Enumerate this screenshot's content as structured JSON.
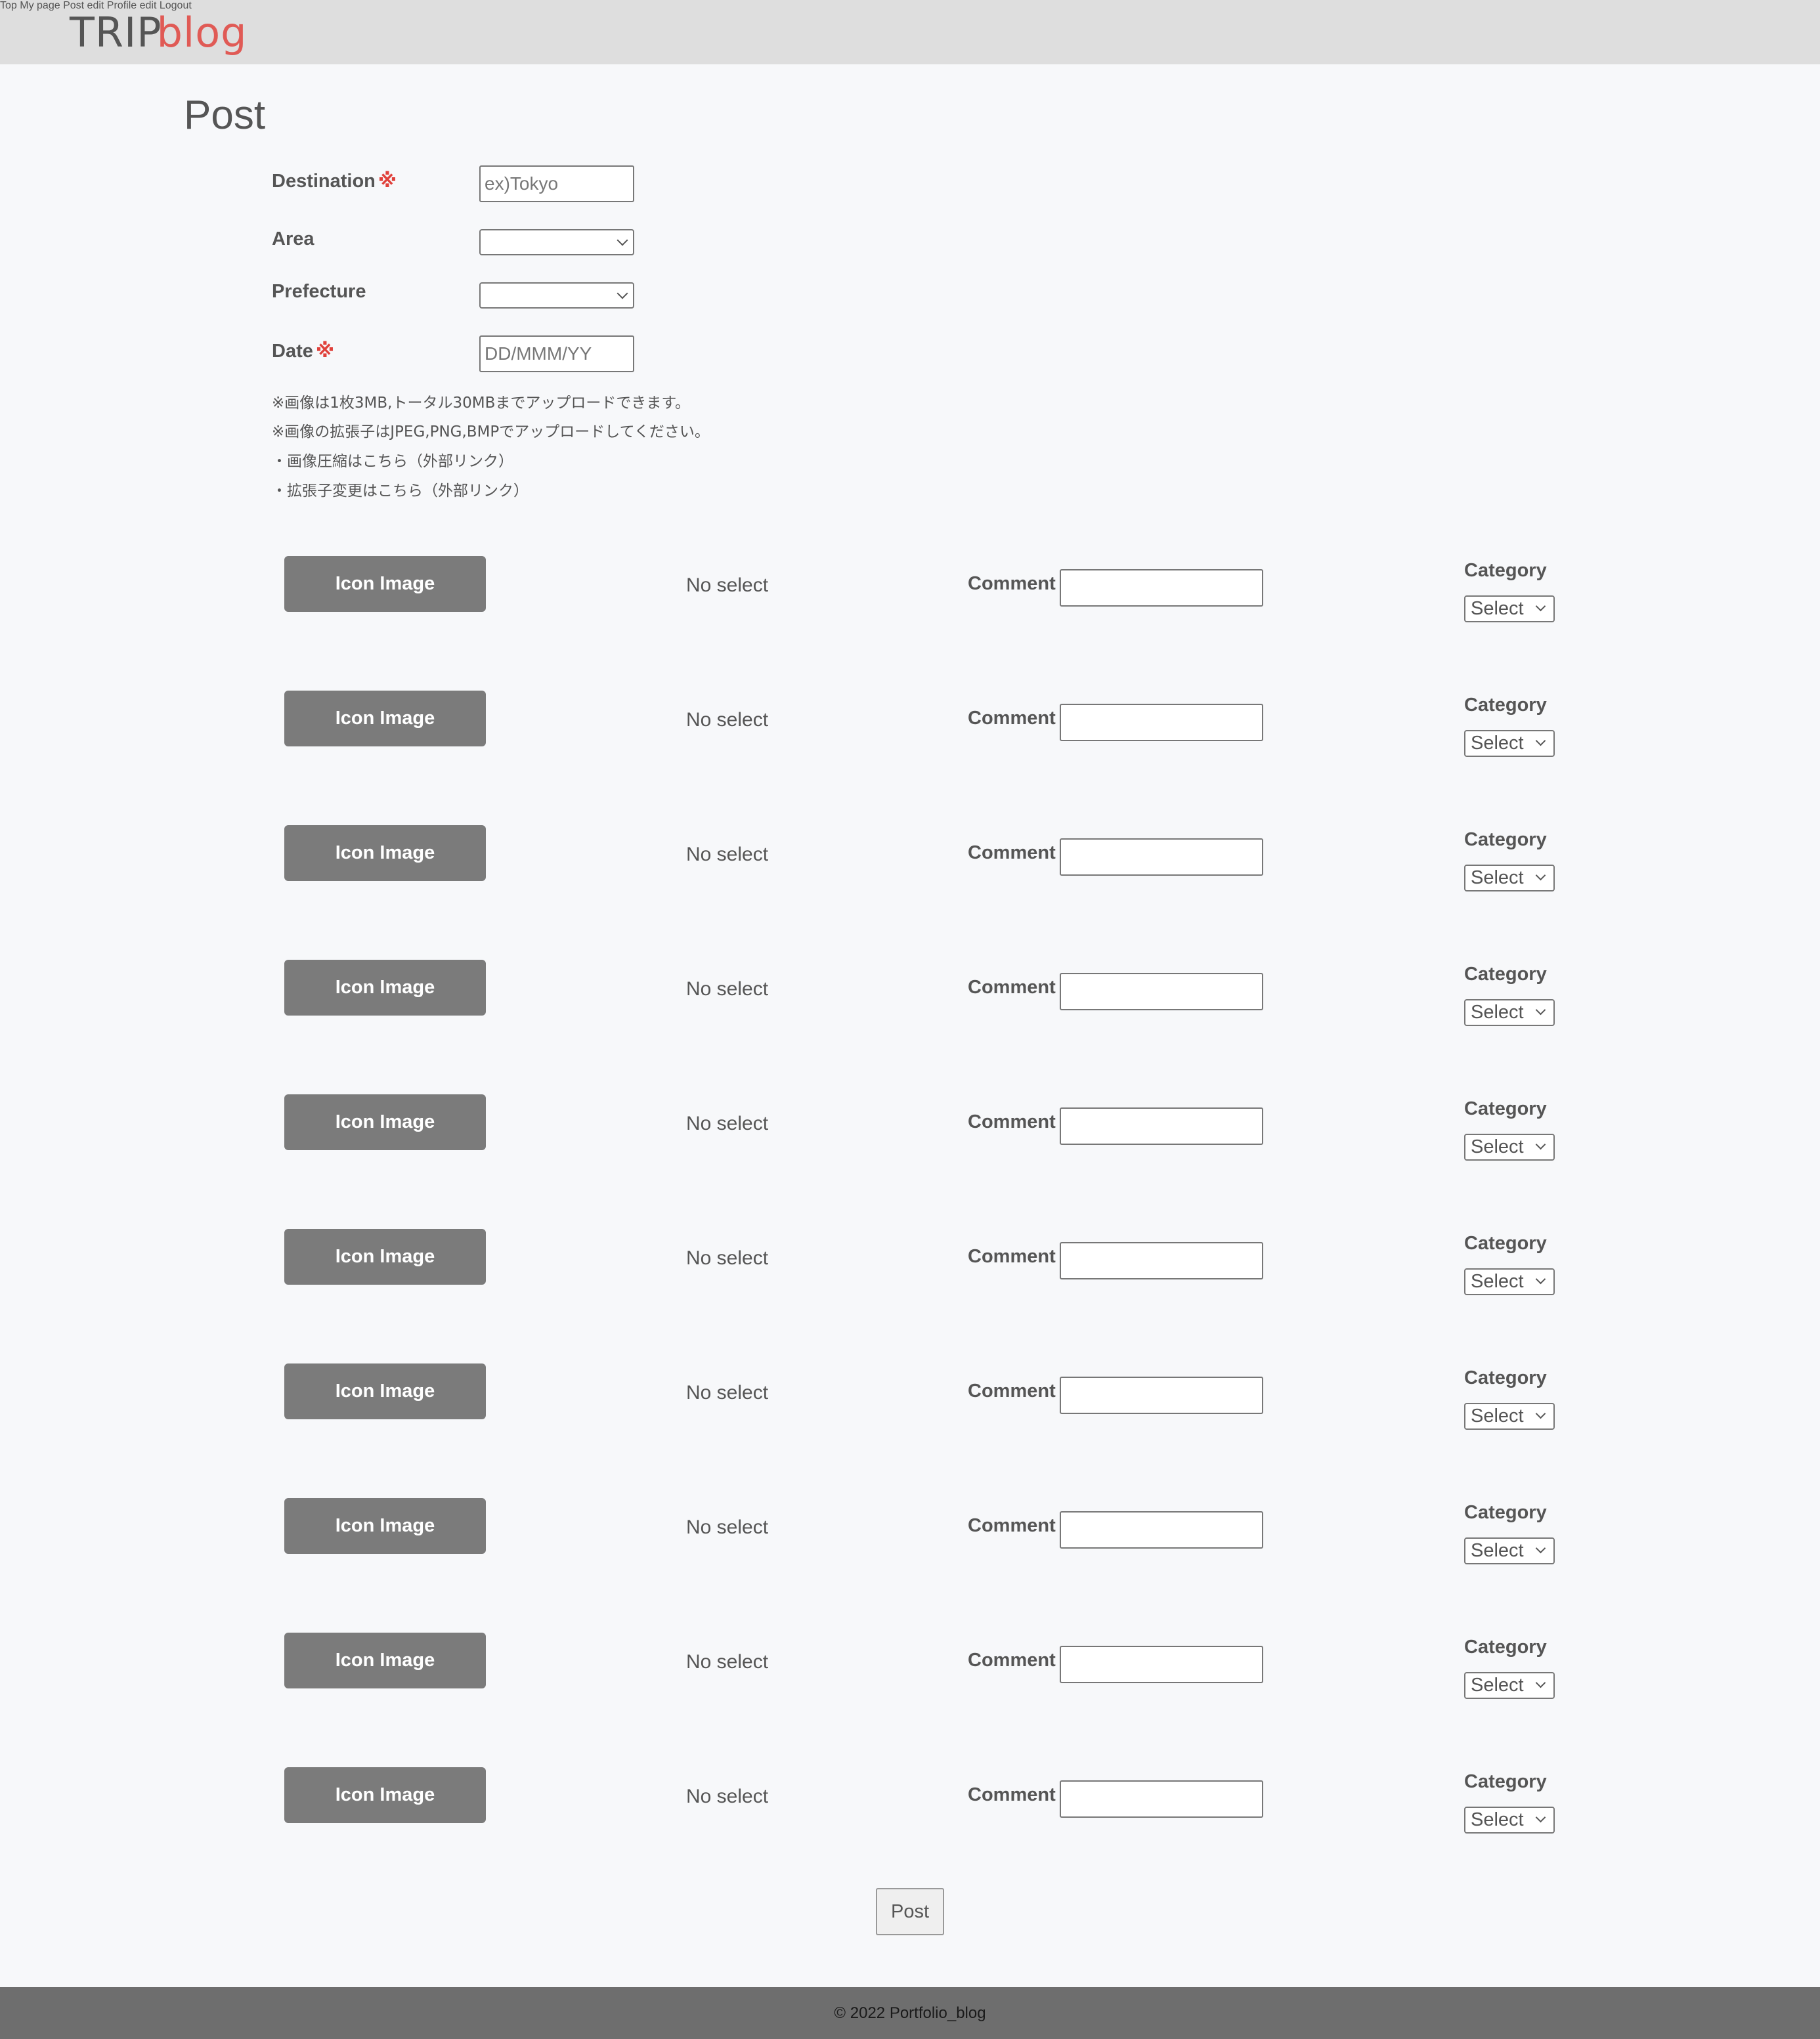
{
  "header": {
    "logo_trip": "TRIP",
    "logo_blog": "blog",
    "nav": [
      "Top",
      "My page",
      "Post edit",
      "Profile edit",
      "Logout"
    ]
  },
  "page_title": "Post",
  "form": {
    "destination": {
      "label": "Destination",
      "required_mark": "※",
      "placeholder": "ex)Tokyo"
    },
    "area": {
      "label": "Area"
    },
    "prefecture": {
      "label": "Prefecture"
    },
    "date": {
      "label": "Date",
      "required_mark": "※",
      "placeholder": "DD/MMM/YY"
    }
  },
  "notes": [
    "※画像は1枚3MB,トータル30MBまでアップロードできます。",
    "※画像の拡張子はJPEG,PNG,BMPでアップロードしてください。",
    "・画像圧縮はこちら（外部リンク）",
    "・拡張子変更はこちら（外部リンク）"
  ],
  "photo_row": {
    "icon_button": "Icon Image",
    "file_status": "No select",
    "comment_label": "Comment",
    "category_label": "Category",
    "category_value": "Select"
  },
  "photo_row_count": 10,
  "post_button": "Post",
  "footer": "© 2022 Portfolio_blog",
  "colors": {
    "header_bg": "#dedede",
    "accent_red": "#e05a55",
    "button_gray": "#7b7b7b",
    "footer_bg": "#6e6e6e"
  }
}
